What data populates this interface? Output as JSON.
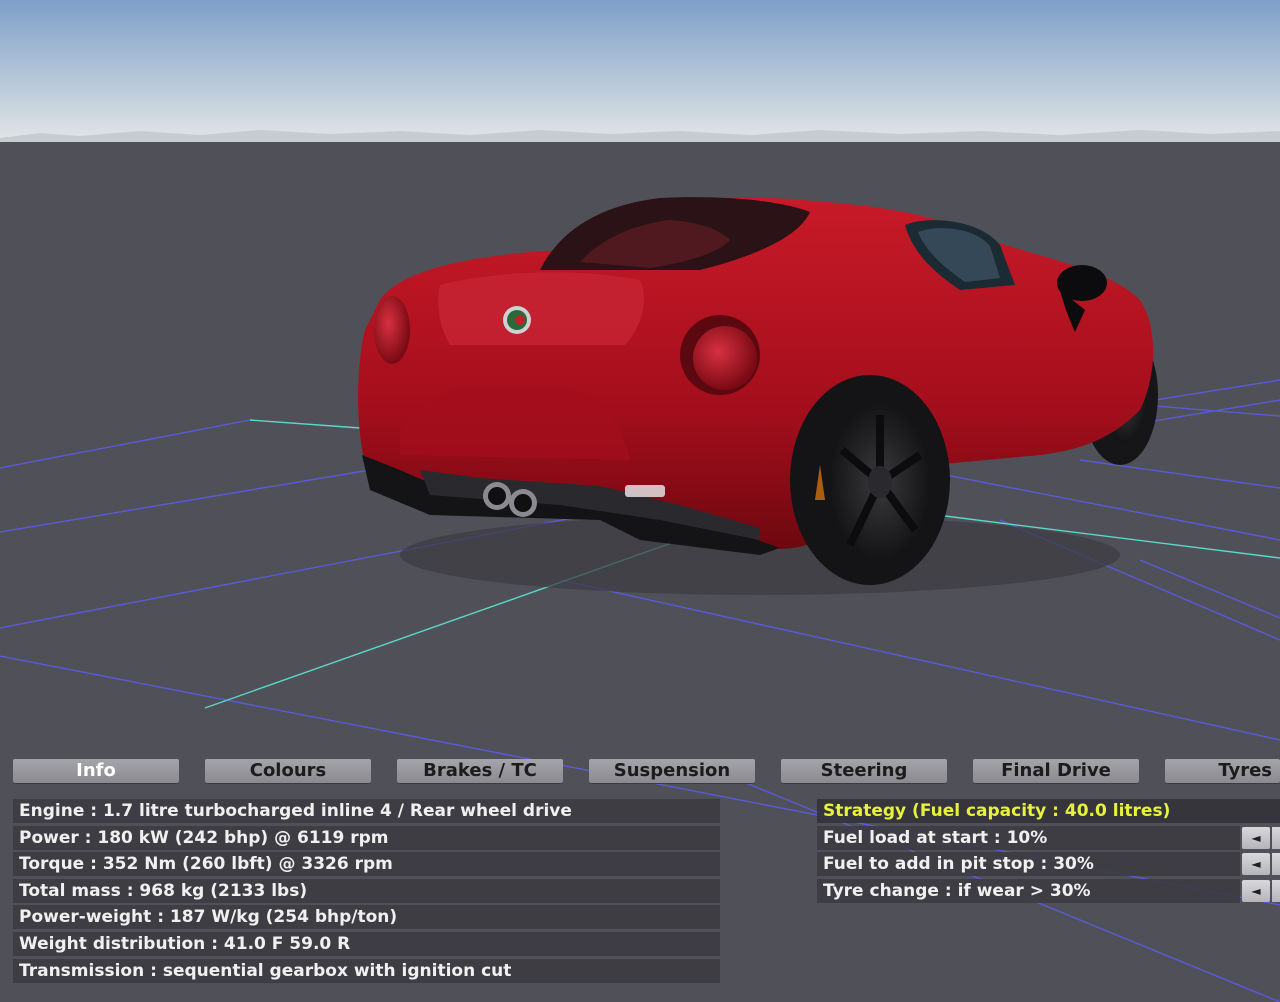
{
  "tabs": [
    {
      "label": "Info",
      "active": true
    },
    {
      "label": "Colours",
      "active": false
    },
    {
      "label": "Brakes / TC",
      "active": false
    },
    {
      "label": "Suspension",
      "active": false
    },
    {
      "label": "Steering",
      "active": false
    },
    {
      "label": "Final Drive",
      "active": false
    },
    {
      "label": "Tyres",
      "active": false
    }
  ],
  "info": [
    "Engine : 1.7 litre turbocharged inline 4 / Rear wheel drive",
    "Power : 180 kW (242 bhp) @ 6119 rpm",
    "Torque : 352 Nm (260 lbft) @ 3326 rpm",
    "Total mass : 968 kg (2133 lbs)",
    "Power-weight : 187 W/kg (254 bhp/ton)",
    "Weight distribution : 41.0 F  59.0 R",
    "Transmission : sequential gearbox with ignition cut"
  ],
  "strategy": {
    "title": "Strategy (Fuel capacity : 40.0 litres)",
    "rows": [
      {
        "label": "Fuel load at start : 10%",
        "button": "◄"
      },
      {
        "label": "Fuel to add in pit stop : 30%",
        "button": "◄"
      },
      {
        "label": "Tyre change : if wear > 30%",
        "button": "◄"
      }
    ]
  },
  "colors": {
    "sky_top": "#7f9fc9",
    "sky_bottom": "#dfe3e6",
    "ground": "#505058",
    "car_body": "#b01020",
    "strategy_title": "#e8f23a"
  }
}
